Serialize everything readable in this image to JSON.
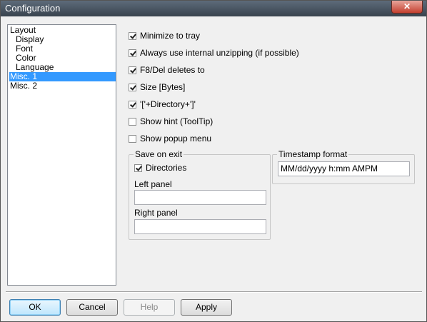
{
  "window": {
    "title": "Configuration",
    "close_label": "✕"
  },
  "tree": {
    "items": [
      {
        "label": "Layout"
      },
      {
        "label": "Display"
      },
      {
        "label": "Font"
      },
      {
        "label": "Color"
      },
      {
        "label": "Language"
      },
      {
        "label": "Misc. 1",
        "selected": true
      },
      {
        "label": "Misc. 2"
      }
    ]
  },
  "options": [
    {
      "label": "Minimize to tray",
      "checked": true
    },
    {
      "label": "Always use internal unzipping (if possible)",
      "checked": true
    },
    {
      "label": "F8/Del deletes to",
      "checked": true
    },
    {
      "label": "Size [Bytes]",
      "checked": true
    },
    {
      "label": "'['+Directory+']'",
      "checked": true
    },
    {
      "label": "Show hint (ToolTip)",
      "checked": false
    },
    {
      "label": "Show popup menu",
      "checked": false
    }
  ],
  "save_on_exit": {
    "title": "Save on exit",
    "directories_label": "Directories",
    "directories_checked": true,
    "left_panel_label": "Left panel",
    "left_panel_value": "",
    "right_panel_label": "Right panel",
    "right_panel_value": ""
  },
  "timestamp": {
    "title": "Timestamp format",
    "value": "MM/dd/yyyy h:mm AMPM"
  },
  "buttons": {
    "ok": "OK",
    "cancel": "Cancel",
    "help": "Help",
    "apply": "Apply"
  }
}
